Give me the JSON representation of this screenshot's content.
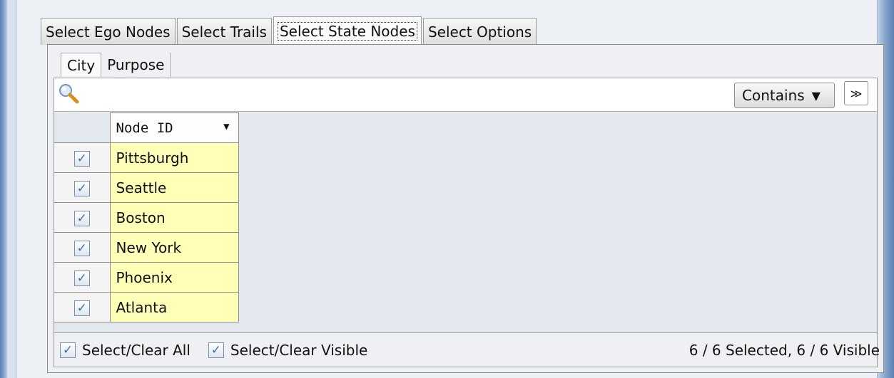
{
  "main_tabs": [
    {
      "label": "Select Ego Nodes",
      "active": false
    },
    {
      "label": "Select Trails",
      "active": false
    },
    {
      "label": "Select State Nodes",
      "active": true
    },
    {
      "label": "Select Options",
      "active": false
    }
  ],
  "sub_tabs": [
    {
      "label": "City",
      "active": true
    },
    {
      "label": "Purpose",
      "active": false
    }
  ],
  "search": {
    "value": "",
    "placeholder": "",
    "icon": "search-icon"
  },
  "filter": {
    "mode_label": "Contains",
    "expand_icon": "double-chevron-down-icon"
  },
  "table": {
    "column_header": "Node ID",
    "rows": [
      {
        "checked": true,
        "name": "Pittsburgh"
      },
      {
        "checked": true,
        "name": "Seattle"
      },
      {
        "checked": true,
        "name": "Boston"
      },
      {
        "checked": true,
        "name": "New York"
      },
      {
        "checked": true,
        "name": "Phoenix"
      },
      {
        "checked": true,
        "name": "Atlanta"
      }
    ]
  },
  "footer": {
    "select_all_label": "Select/Clear All",
    "select_visible_label": "Select/Clear Visible",
    "status": "6 / 6 Selected, 6 / 6 Visible"
  },
  "colors": {
    "row_highlight": "#ffffb7",
    "check": "#3c6fb0"
  }
}
